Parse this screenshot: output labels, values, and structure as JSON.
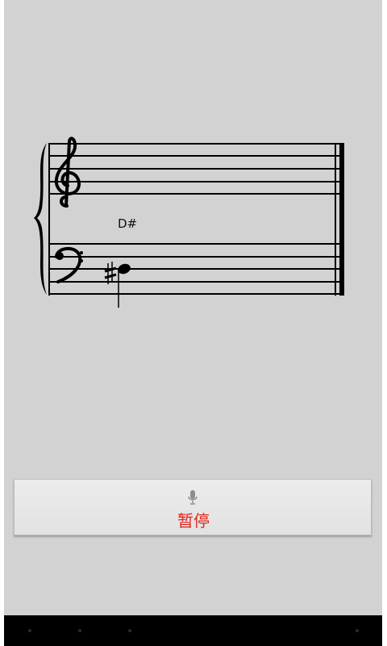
{
  "score": {
    "note_name": "D#",
    "clefs": [
      "treble-clef",
      "bass-clef"
    ],
    "accidental": "sharp"
  },
  "button": {
    "label": "暂停",
    "icon": "microphone-icon",
    "label_color": "#e0251b"
  },
  "colors": {
    "background": "#d2d2d2",
    "staff": "#000000",
    "nav_bar": "#000000"
  }
}
